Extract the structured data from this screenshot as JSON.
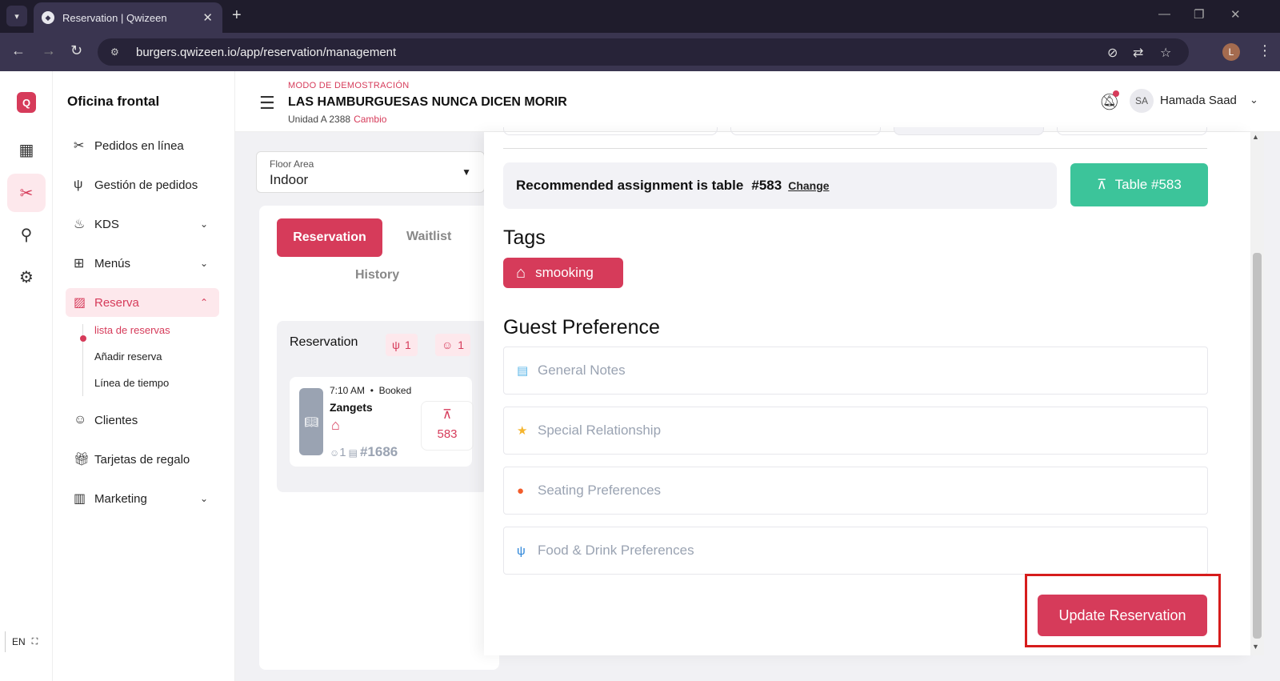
{
  "browser": {
    "tab_title": "Reservation | Qwizeen",
    "url": "burgers.qwizeen.io/app/reservation/management",
    "profile_initial": "L"
  },
  "rail": {
    "logo": "Q",
    "language": "EN"
  },
  "sidebar": {
    "title": "Oficina frontal",
    "items": [
      {
        "label": "Pedidos en línea",
        "icon": "utensils-crossed-icon"
      },
      {
        "label": "Gestión de pedidos",
        "icon": "fork-knife-icon"
      },
      {
        "label": "KDS",
        "icon": "chef-hat-icon"
      },
      {
        "label": "Menús",
        "icon": "grid-icon"
      },
      {
        "label": "Reserva",
        "icon": "reservation-icon"
      },
      {
        "label": "Clientes",
        "icon": "users-icon"
      },
      {
        "label": "Tarjetas de regalo",
        "icon": "gift-icon"
      },
      {
        "label": "Marketing",
        "icon": "chart-icon"
      }
    ],
    "sub_items": [
      "lista de reservas",
      "Añadir reserva",
      "Línea de tiempo"
    ]
  },
  "header": {
    "demo_mode": "MODO DE DEMOSTRACIÓN",
    "restaurant": "LAS HAMBURGUESAS NUNCA DICEN MORIR",
    "unit": "Unidad A 2388",
    "change": "Cambio",
    "user_initials": "SA",
    "user_name": "Hamada Saad"
  },
  "main": {
    "floor_label": "Floor Area",
    "floor_value": "Indoor",
    "tabs": {
      "reservation": "Reservation",
      "waitlist": "Waitlist",
      "history": "History"
    },
    "list": {
      "title": "Reservation",
      "badge_orders": "1",
      "badge_guests": "1",
      "entry": {
        "time": "7:10 AM",
        "status": "Booked",
        "name": "Zangets",
        "party": "1",
        "id": "#1686",
        "table": "583"
      }
    }
  },
  "drawer": {
    "recommended_text": "Recommended assignment is table",
    "recommended_table": "#583",
    "change_link": "Change",
    "table_button": "Table #583",
    "tags_title": "Tags",
    "tag": "smooking",
    "guest_pref_title": "Guest Preference",
    "preferences": [
      {
        "label": "General Notes",
        "icon": "note-icon",
        "color": "#5bb6e8"
      },
      {
        "label": "Special Relationship",
        "icon": "star-icon",
        "color": "#f5b52e"
      },
      {
        "label": "Seating Preferences",
        "icon": "seat-icon",
        "color": "#f25c2b"
      },
      {
        "label": "Food & Drink Preferences",
        "icon": "utensils-icon",
        "color": "#2a84d8"
      }
    ],
    "update_button": "Update Reservation"
  },
  "colors": {
    "brand": "#d63b5a",
    "success": "#3cc49a",
    "highlight_box": "#d61c1c"
  }
}
